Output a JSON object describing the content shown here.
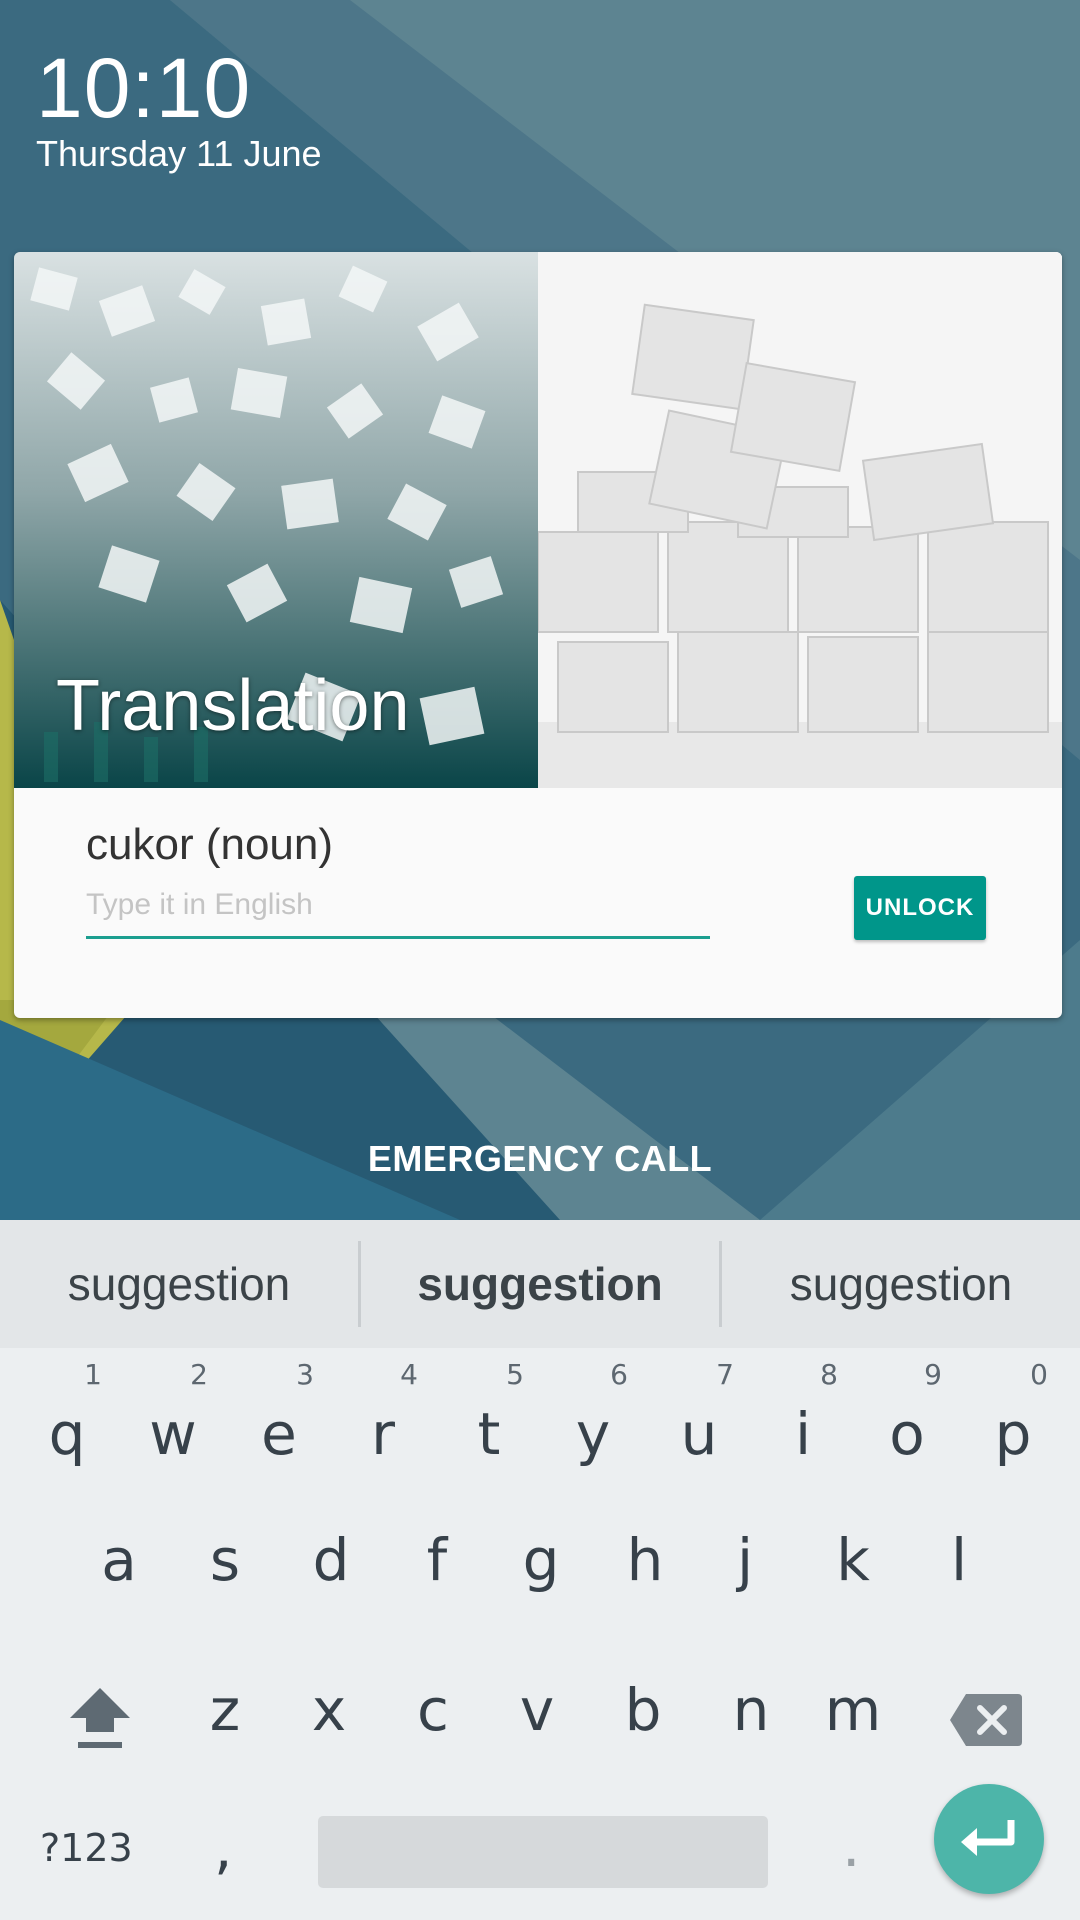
{
  "lockscreen": {
    "time": "10:10",
    "date": "Thursday 11 June"
  },
  "card": {
    "title": "Translation",
    "word": "cukor (noun)",
    "input_placeholder": "Type it in English",
    "input_value": "",
    "unlock_label": "UNLOCK"
  },
  "emergency_call_label": "EMERGENCY CALL",
  "keyboard": {
    "suggestions": [
      "suggestion",
      "suggestion",
      "suggestion"
    ],
    "row1": [
      {
        "key": "q",
        "hint": "1"
      },
      {
        "key": "w",
        "hint": "2"
      },
      {
        "key": "e",
        "hint": "3"
      },
      {
        "key": "r",
        "hint": "4"
      },
      {
        "key": "t",
        "hint": "5"
      },
      {
        "key": "y",
        "hint": "6"
      },
      {
        "key": "u",
        "hint": "7"
      },
      {
        "key": "i",
        "hint": "8"
      },
      {
        "key": "o",
        "hint": "9"
      },
      {
        "key": "p",
        "hint": "0"
      }
    ],
    "row2": [
      "a",
      "s",
      "d",
      "f",
      "g",
      "h",
      "j",
      "k",
      "l"
    ],
    "row3": [
      "z",
      "x",
      "c",
      "v",
      "b",
      "n",
      "m"
    ],
    "symbols_label": "?123",
    "comma": ",",
    "period": "."
  },
  "colors": {
    "accent": "#00968a",
    "enter_button": "#4db5a9",
    "wallpaper": "#5d8491"
  },
  "icons": [
    "shift-icon",
    "backspace-icon",
    "enter-icon"
  ]
}
